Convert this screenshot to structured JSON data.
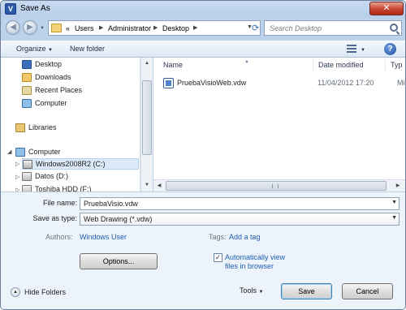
{
  "window": {
    "title": "Save As",
    "app_icon_glyph": "V",
    "close_glyph": "✕"
  },
  "nav": {
    "back_glyph": "◀",
    "forward_glyph": "▶",
    "breadcrumb_prefix": "«",
    "breadcrumbs": [
      "Users",
      "Administrator",
      "Desktop"
    ],
    "search_placeholder": "Search Desktop"
  },
  "toolbar": {
    "organize_label": "Organize",
    "new_folder_label": "New folder",
    "help_glyph": "?"
  },
  "nav_pane": {
    "items": [
      {
        "label": "Desktop",
        "icon": "desktop-icon"
      },
      {
        "label": "Downloads",
        "icon": "downloads-icon"
      },
      {
        "label": "Recent Places",
        "icon": "recent-places-icon"
      },
      {
        "label": "Computer",
        "icon": "computer-icon"
      },
      {
        "label": "Libraries",
        "icon": "libraries-icon"
      },
      {
        "label": "Computer",
        "icon": "computer-icon"
      },
      {
        "label": "Windows2008R2 (C:)",
        "icon": "windows-drive-icon"
      },
      {
        "label": "Datos (D:)",
        "icon": "drive-icon"
      },
      {
        "label": "Toshiba HDD (F:)",
        "icon": "drive-icon"
      }
    ]
  },
  "file_list": {
    "columns": [
      "Name",
      "Date modified",
      "Typ"
    ],
    "rows": [
      {
        "name": "PruebaVisioWeb.vdw",
        "date": "11/04/2012 17:20",
        "type": "Mic"
      }
    ]
  },
  "form": {
    "file_name_label": "File name:",
    "file_name_value": "PruebaVisio.vdw",
    "save_as_type_label": "Save as type:",
    "save_as_type_value": "Web Drawing (*.vdw)",
    "authors_label": "Authors:",
    "authors_value": "Windows User",
    "tags_label": "Tags:",
    "tags_value": "Add a tag",
    "options_button": "Options...",
    "auto_view_line1": "Automatically view",
    "auto_view_line2": "files in browser",
    "auto_view_checked": true
  },
  "footer": {
    "hide_folders_label": "Hide Folders",
    "tools_label": "Tools",
    "save_label": "Save",
    "cancel_label": "Cancel"
  }
}
